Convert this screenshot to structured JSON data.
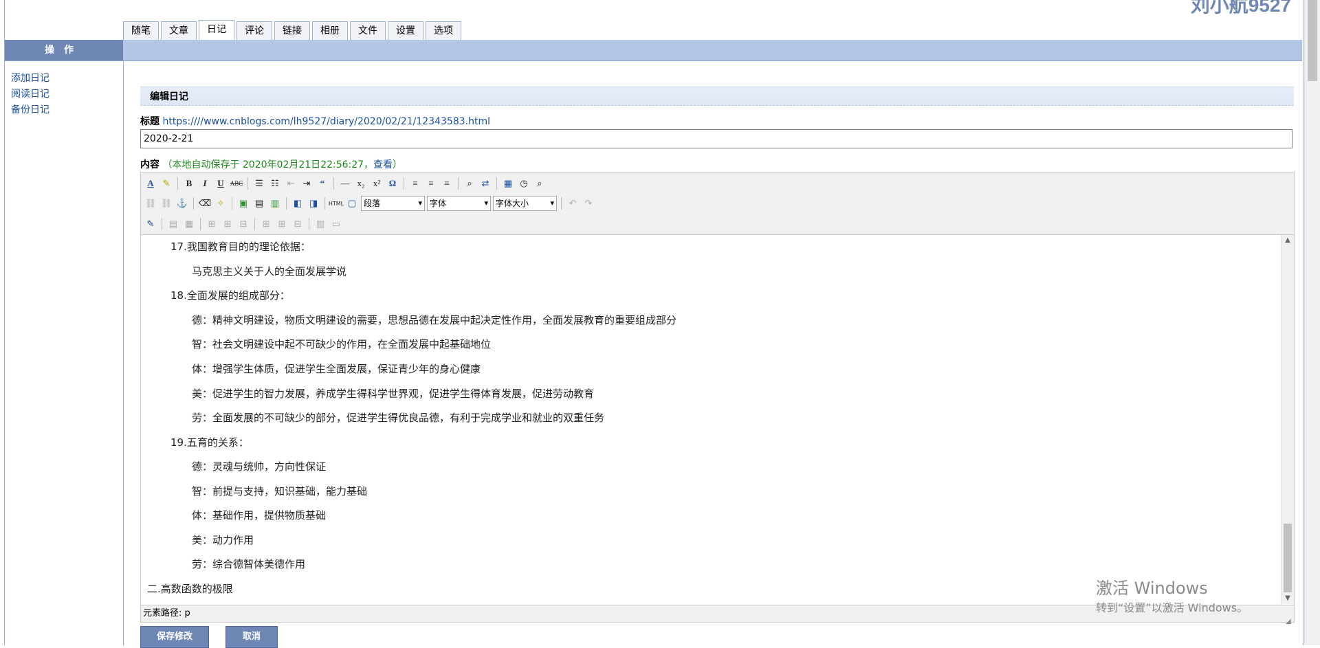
{
  "header": {
    "name": "刘小航9527"
  },
  "tabs": [
    {
      "label": "随笔"
    },
    {
      "label": "文章"
    },
    {
      "label": "日记",
      "active": true
    },
    {
      "label": "评论"
    },
    {
      "label": "链接"
    },
    {
      "label": "相册"
    },
    {
      "label": "文件"
    },
    {
      "label": "设置"
    },
    {
      "label": "选项"
    }
  ],
  "sidebar": {
    "header": "操作",
    "links": [
      "添加日记",
      "阅读日记",
      "备份日记"
    ]
  },
  "form": {
    "section_title": "编辑日记",
    "title_label": "标题",
    "title_url": "https:////www.cnblogs.com/lh9527/diary/2020/02/21/12343583.html",
    "title_value": "2020-2-21",
    "content_label": "内容",
    "autosave_text": "（本地自动保存于 2020年02月21日22:56:27，",
    "autosave_link": "查看",
    "autosave_close": "）"
  },
  "toolbar": {
    "format_select": "段落",
    "font_select": "字体",
    "size_select": "字体大小"
  },
  "content_lines": [
    {
      "text": "17.我国教育目的的理论依据：",
      "indent": 1
    },
    {
      "text": "马克思主义关于人的全面发展学说",
      "indent": 2
    },
    {
      "text": "18.全面发展的组成部分：",
      "indent": 1
    },
    {
      "text": "德：精神文明建设，物质文明建设的需要，思想品德在发展中起决定性作用，全面发展教育的重要组成部分",
      "indent": 2
    },
    {
      "text": "智：社会文明建设中起不可缺少的作用，在全面发展中起基础地位",
      "indent": 2
    },
    {
      "text": "体：增强学生体质，促进学生全面发展，保证青少年的身心健康",
      "indent": 2
    },
    {
      "text": "美：促进学生的智力发展，养成学生得科学世界观，促进学生得体育发展，促进劳动教育",
      "indent": 2
    },
    {
      "text": "劳：全面发展的不可缺少的部分，促进学生得优良品德，有利于完成学业和就业的双重任务",
      "indent": 2
    },
    {
      "text": "19.五育的关系：",
      "indent": 1
    },
    {
      "text": "德：灵魂与统帅，方向性保证",
      "indent": 2
    },
    {
      "text": "智：前提与支持，知识基础，能力基础",
      "indent": 2
    },
    {
      "text": "体：基础作用，提供物质基础",
      "indent": 2
    },
    {
      "text": "美：动力作用",
      "indent": 2
    },
    {
      "text": "劳：综合德智体美德作用",
      "indent": 2
    },
    {
      "text": "二.高数函数的极限",
      "indent": 0
    }
  ],
  "statusbar": {
    "path": "元素路径: p"
  },
  "buttons": {
    "save": "保存修改",
    "cancel": "取消"
  },
  "watermark": {
    "line1": "激活 Windows",
    "line2": "转到“设置”以激活 Windows。"
  }
}
